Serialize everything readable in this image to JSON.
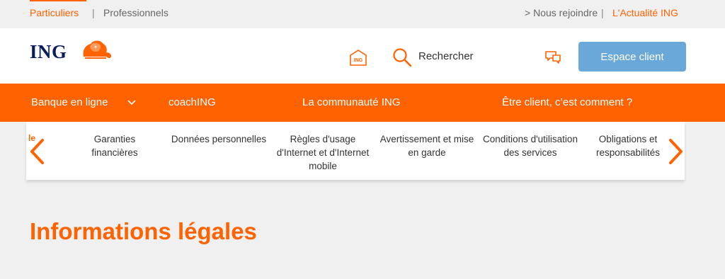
{
  "topbar": {
    "particuliers": "Particuliers",
    "separator": "|",
    "professionnels": "Professionnels",
    "nous_rejoindre": "> Nous rejoindre",
    "actualite": "L'Actualité ING"
  },
  "header": {
    "logo": "ING",
    "ing_icon_label": "ING",
    "search_label": "Rechercher",
    "client_button": "Espace client"
  },
  "nav": {
    "items": [
      "Banque en ligne",
      "coachING",
      "La communauté ING",
      "Être client, c’est comment ?"
    ]
  },
  "subnav": {
    "fade_text": "le",
    "items": [
      "Garanties financières",
      "Données personnelles",
      "Règles d'usage d'Internet et d'Internet mobile",
      "Avertissement et mise en garde",
      "Conditions d'utilisation des services",
      "Obligations et responsabilités"
    ]
  },
  "page": {
    "title": "Informations légales"
  },
  "colors": {
    "brand_orange": "#ff6200",
    "brand_navy": "#0a1c5c",
    "client_button": "#69a8d9"
  },
  "icons": [
    "ing-home-icon",
    "search-icon",
    "chat-icon",
    "chevron-down-icon",
    "arrow-left-icon",
    "arrow-right-icon",
    "lion-logo-icon"
  ]
}
